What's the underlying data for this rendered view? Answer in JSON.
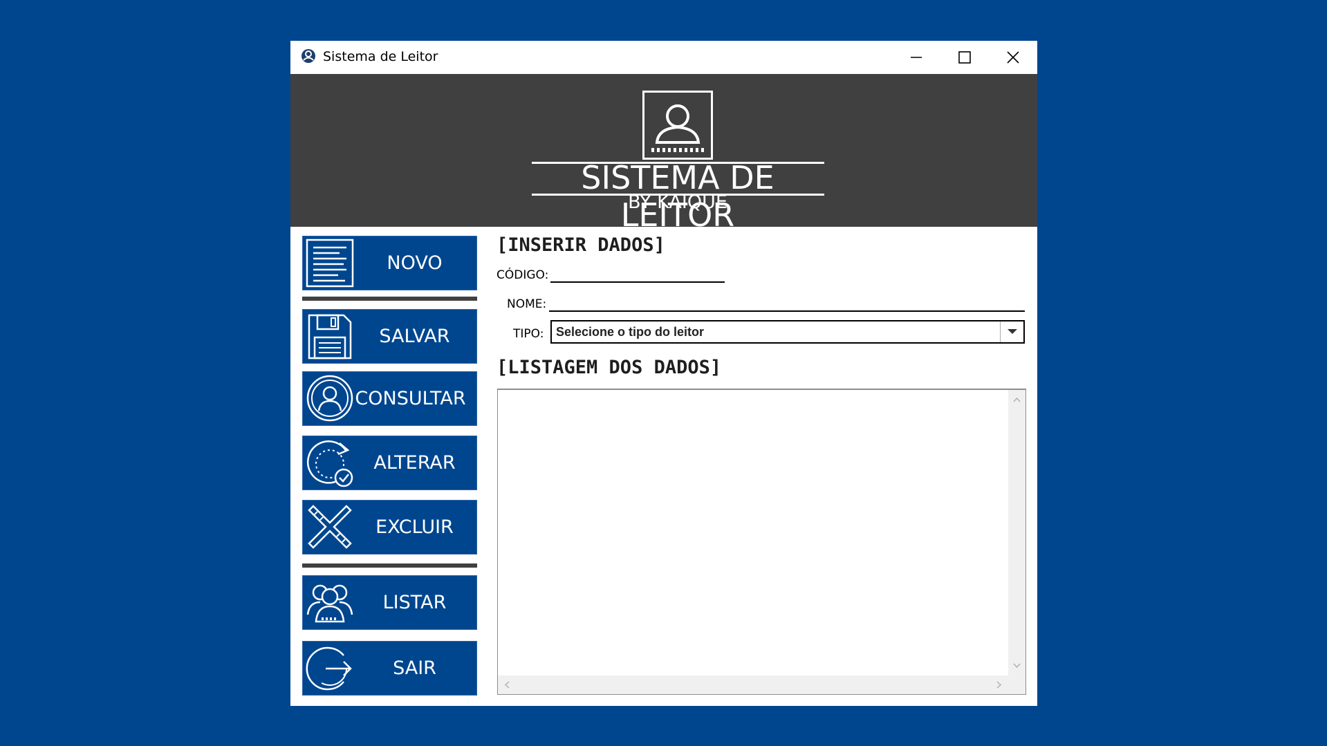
{
  "window": {
    "title": "Sistema de Leitor"
  },
  "banner": {
    "logo_title": "SISTEMA DE LEITOR",
    "logo_subtitle": "BY KAIQUE"
  },
  "sidebar": {
    "buttons": [
      {
        "label": "NOVO",
        "icon": "document-lines-icon"
      },
      {
        "label": "SALVAR",
        "icon": "floppy-disk-icon"
      },
      {
        "label": "CONSULTAR",
        "icon": "user-circle-icon"
      },
      {
        "label": "ALTERAR",
        "icon": "refresh-check-icon"
      },
      {
        "label": "EXCLUIR",
        "icon": "x-cross-icon"
      },
      {
        "label": "LISTAR",
        "icon": "users-group-icon"
      },
      {
        "label": "SAIR",
        "icon": "exit-arrow-icon"
      }
    ]
  },
  "form": {
    "insert_title": "[INSERIR DADOS]",
    "codigo_label": "CÓDIGO:",
    "codigo_value": "",
    "nome_label": "NOME:",
    "nome_value": "",
    "tipo_label": "TIPO:",
    "tipo_selected": "Selecione o tipo do leitor",
    "list_title": "[LISTAGEM DOS DADOS]"
  },
  "colors": {
    "background": "#00468F",
    "button": "#00468F",
    "banner": "#404040"
  }
}
